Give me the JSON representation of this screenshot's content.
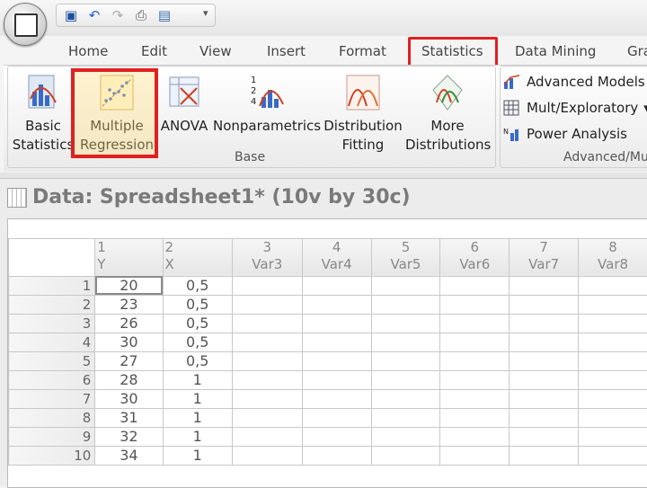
{
  "tabs": [
    "Home",
    "Edit",
    "View",
    "Insert",
    "Format",
    "Statistics",
    "Data Mining",
    "Gra"
  ],
  "active_tab": "Statistics",
  "ribbon": {
    "base_group_label": "Base",
    "advanced_group_label": "Advanced/Mu",
    "buttons": {
      "basic_statistics": [
        "Basic",
        "Statistics"
      ],
      "multiple_regression": [
        "Multiple",
        "Regression"
      ],
      "anova": [
        "ANOVA"
      ],
      "nonparametrics": [
        "Nonparametrics"
      ],
      "distribution_fitting": [
        "Distribution",
        "Fitting"
      ],
      "more_distributions": [
        "More",
        "Distributions"
      ]
    },
    "advanced": [
      "Advanced Models",
      "Mult/Exploratory",
      "Power Analysis"
    ]
  },
  "window": {
    "title": "Data: Spreadsheet1* (10v by 30c)"
  },
  "sheet": {
    "columns": [
      {
        "num": "1",
        "name": "Y"
      },
      {
        "num": "2",
        "name": "X"
      },
      {
        "num": "3",
        "name": "Var3"
      },
      {
        "num": "4",
        "name": "Var4"
      },
      {
        "num": "5",
        "name": "Var5"
      },
      {
        "num": "6",
        "name": "Var6"
      },
      {
        "num": "7",
        "name": "Var7"
      },
      {
        "num": "8",
        "name": "Var8"
      }
    ],
    "rows": [
      {
        "n": "1",
        "y": "20",
        "x": "0,5"
      },
      {
        "n": "2",
        "y": "23",
        "x": "0,5"
      },
      {
        "n": "3",
        "y": "26",
        "x": "0,5"
      },
      {
        "n": "4",
        "y": "30",
        "x": "0,5"
      },
      {
        "n": "5",
        "y": "27",
        "x": "0,5"
      },
      {
        "n": "6",
        "y": "28",
        "x": "1"
      },
      {
        "n": "7",
        "y": "30",
        "x": "1"
      },
      {
        "n": "8",
        "y": "31",
        "x": "1"
      },
      {
        "n": "9",
        "y": "32",
        "x": "1"
      },
      {
        "n": "10",
        "y": "34",
        "x": "1"
      }
    ]
  },
  "colors": {
    "highlight": "#e02020"
  }
}
